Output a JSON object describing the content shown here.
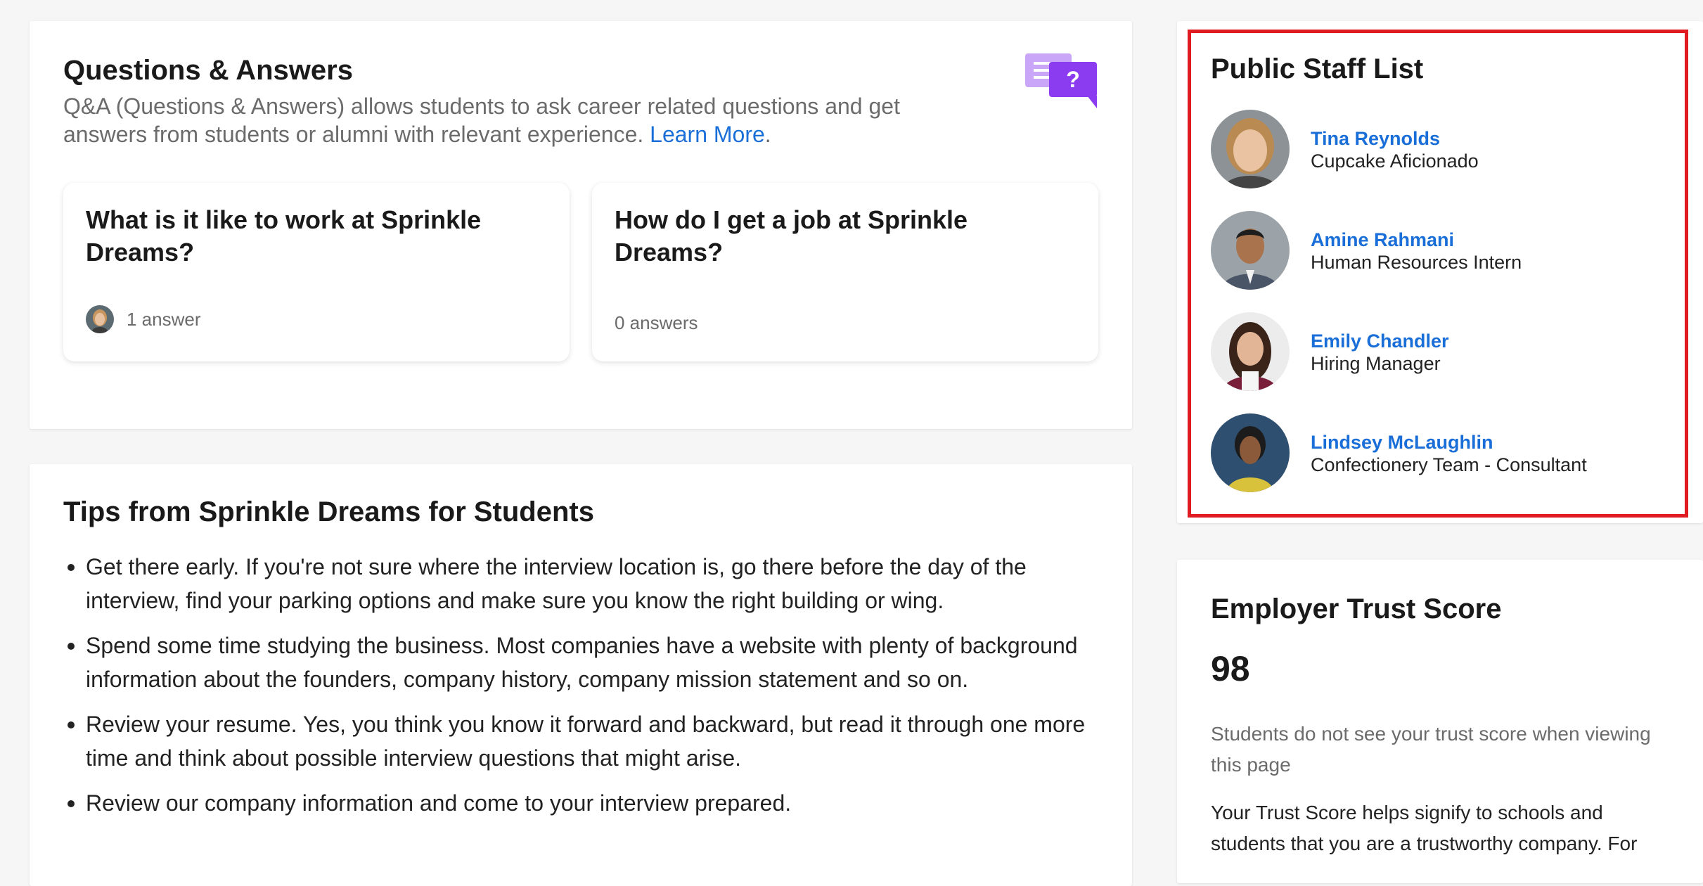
{
  "qa": {
    "title": "Questions & Answers",
    "description": "Q&A (Questions & Answers) allows students to ask career related questions and get answers from students or alumni with relevant experience. ",
    "learn_more": "Learn More",
    "learn_more_suffix": ".",
    "icon": "chat-question-icon",
    "accent": "#8b3cf0",
    "questions": [
      {
        "question": "What is it like to work at Sprinkle Dreams?",
        "answers": "1 answer"
      },
      {
        "question": "How do I get a job at Sprinkle Dreams?",
        "answers": "0 answers"
      }
    ]
  },
  "tips": {
    "title": "Tips from Sprinkle Dreams for Students",
    "items": [
      "Get there early. If you're not sure where the interview location is, go there before the day of the interview, find your parking options and make sure you know the right building or wing.",
      "Spend some time studying the business. Most companies have a website with plenty of background information about the founders, company history, company mission statement and so on.",
      "Review your resume. Yes, you think you know it forward and backward, but read it through one more time and think about possible interview questions that might arise.",
      "Review our company information and come to your interview prepared."
    ]
  },
  "staff": {
    "title": "Public Staff List",
    "members": [
      {
        "name": "Tina Reynolds",
        "role": "Cupcake Aficionado"
      },
      {
        "name": "Amine Rahmani",
        "role": "Human Resources Intern"
      },
      {
        "name": "Emily Chandler",
        "role": "Hiring Manager"
      },
      {
        "name": "Lindsey McLaughlin",
        "role": "Confectionery Team - Consultant"
      }
    ]
  },
  "trust": {
    "title": "Employer Trust Score",
    "score": "98",
    "note": "Students do not see your trust score when viewing this page",
    "description": "Your Trust Score helps signify to schools and students that you are a trustworthy company. For"
  },
  "colors": {
    "link": "#1a6ed8",
    "highlight_border": "#e11b22"
  }
}
